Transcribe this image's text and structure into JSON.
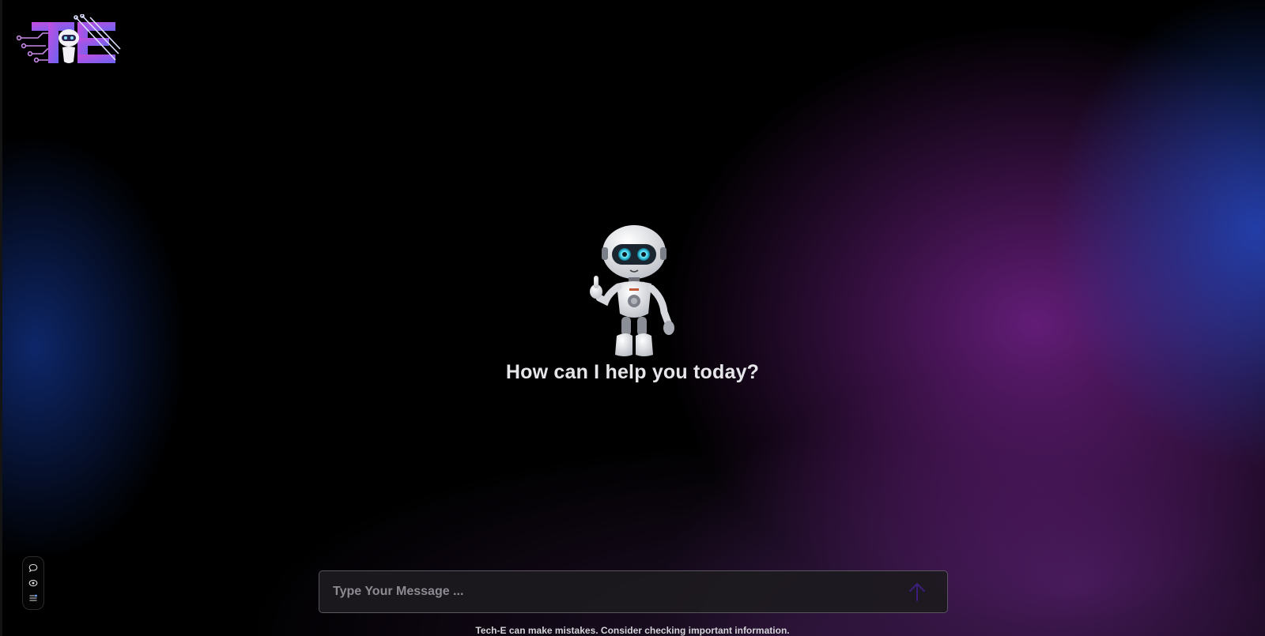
{
  "app": {
    "logo_text": "TE",
    "brand": "Tech-E"
  },
  "hero": {
    "headline": "How can I help you today?",
    "mascot_icon": "robot-thumbs-up-icon"
  },
  "toolbar": {
    "items": [
      {
        "icon": "chat-bubble-icon"
      },
      {
        "icon": "eye-icon"
      },
      {
        "icon": "sliders-icon"
      }
    ]
  },
  "composer": {
    "placeholder": "Type Your Message ...",
    "value": "",
    "send_icon": "arrow-up-icon"
  },
  "footer": {
    "disclaimer": "Tech-E can make mistakes. Consider checking important information."
  },
  "colors": {
    "background": "#000000",
    "accent_purple": "#8a3fe0",
    "accent_blue": "#234bc8",
    "send_arrow": "#3b1d7a"
  }
}
